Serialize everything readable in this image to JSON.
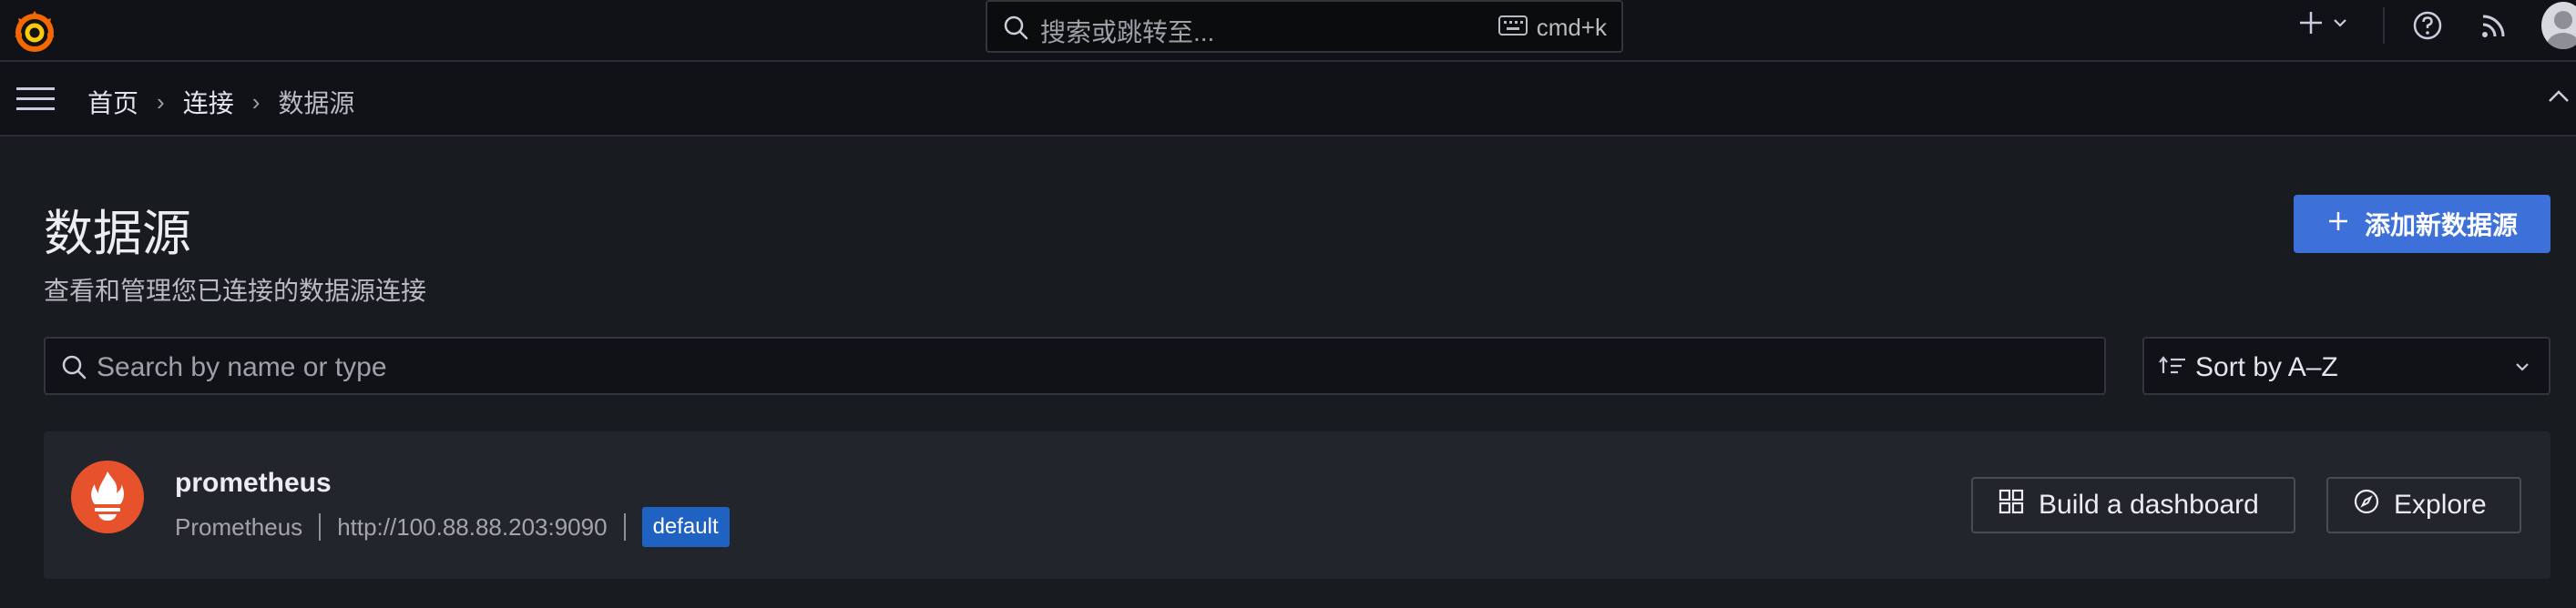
{
  "topbar": {
    "search_placeholder": "搜索或跳转至...",
    "shortcut": "cmd+k"
  },
  "breadcrumb": {
    "items": [
      "首页",
      "连接",
      "数据源"
    ]
  },
  "page": {
    "title": "数据源",
    "subtitle": "查看和管理您已连接的数据源连接",
    "add_button": "添加新数据源"
  },
  "filter": {
    "placeholder": "Search by name or type",
    "sort_label": "Sort by A–Z"
  },
  "datasources": [
    {
      "name": "prometheus",
      "type": "Prometheus",
      "url": "http://100.88.88.203:9090",
      "badge": "default",
      "build_label": "Build a dashboard",
      "explore_label": "Explore"
    }
  ],
  "colors": {
    "accent": "#3d71d9",
    "badge": "#1f62c1",
    "logo_orange": "#f46800",
    "prometheus_red": "#e6522c"
  },
  "icons": {
    "logo": "grafana-logo-icon",
    "search": "search-icon",
    "keyboard": "keyboard-icon",
    "plus": "plus-icon",
    "help": "help-icon",
    "news": "rss-icon",
    "menu": "menu-icon",
    "sort": "sort-icon"
  }
}
